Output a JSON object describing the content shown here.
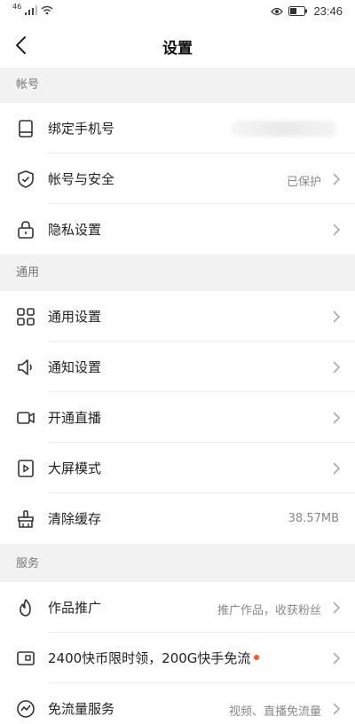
{
  "statusbar": {
    "carrier": "46",
    "time": "23:46"
  },
  "header": {
    "title": "设置"
  },
  "sections": {
    "account": "帐号",
    "general": "通用",
    "services": "服务"
  },
  "rows": {
    "bind_phone": {
      "label": "绑定手机号",
      "value": ""
    },
    "account_security": {
      "label": "帐号与安全",
      "value": "已保护"
    },
    "privacy": {
      "label": "隐私设置"
    },
    "general_settings": {
      "label": "通用设置"
    },
    "notifications": {
      "label": "通知设置"
    },
    "live": {
      "label": "开通直播"
    },
    "big_screen": {
      "label": "大屏模式"
    },
    "clear_cache": {
      "label": "清除缓存",
      "value": "38.57MB"
    },
    "promotion": {
      "label": "作品推广",
      "value": "推广作品，收获粉丝"
    },
    "coins": {
      "label": "2400快币限时领，200G快手免流"
    },
    "free_data": {
      "label": "免流量服务",
      "value": "视频、直播免流量"
    }
  },
  "colors": {
    "accent_dot": "#ff5a1f",
    "background": "#f2f2f2"
  },
  "icons": {
    "bind_phone": "phone-icon",
    "account_security": "shield-icon",
    "privacy": "lock-icon",
    "general_settings": "grid-icon",
    "notifications": "speaker-icon",
    "live": "camera-icon",
    "big_screen": "play-icon",
    "clear_cache": "broom-icon",
    "promotion": "flame-icon",
    "coins": "card-icon",
    "free_data": "wave-icon"
  }
}
